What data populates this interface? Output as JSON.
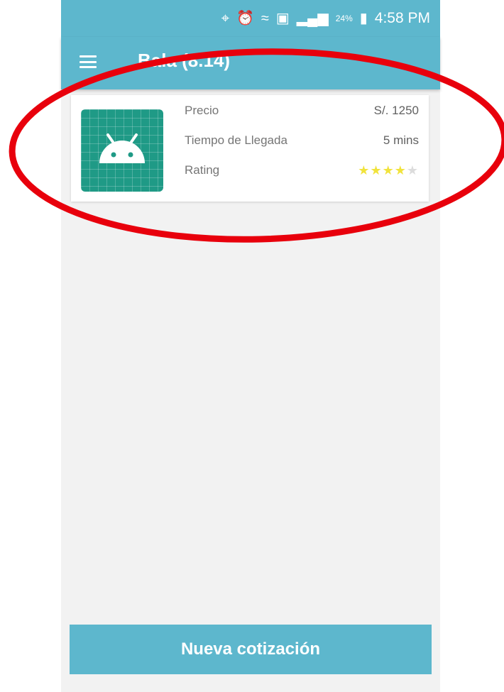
{
  "status_bar": {
    "battery_percent": "24%",
    "time": "4:58 PM",
    "icons": [
      "location-icon",
      "alarm-icon",
      "wifi-icon",
      "sim-icon",
      "signal-icon",
      "battery-icon"
    ]
  },
  "app_bar": {
    "title": "Bala (8.14)",
    "menu_icon": "menu-icon"
  },
  "quote_card": {
    "image_icon": "android-icon",
    "price_label": "Precio",
    "price_value": "S/. 1250",
    "arrival_label": "Tiempo de Llegada",
    "arrival_value": "5 mins",
    "rating_label": "Rating",
    "rating_value": 4,
    "rating_max": 5
  },
  "footer": {
    "button_label": "Nueva cotización"
  },
  "colors": {
    "primary": "#5db7cd",
    "thumb": "#1f9a86",
    "star_on": "#f1e33c",
    "star_off": "#dcdcdc",
    "annotation": "#e8000c"
  }
}
